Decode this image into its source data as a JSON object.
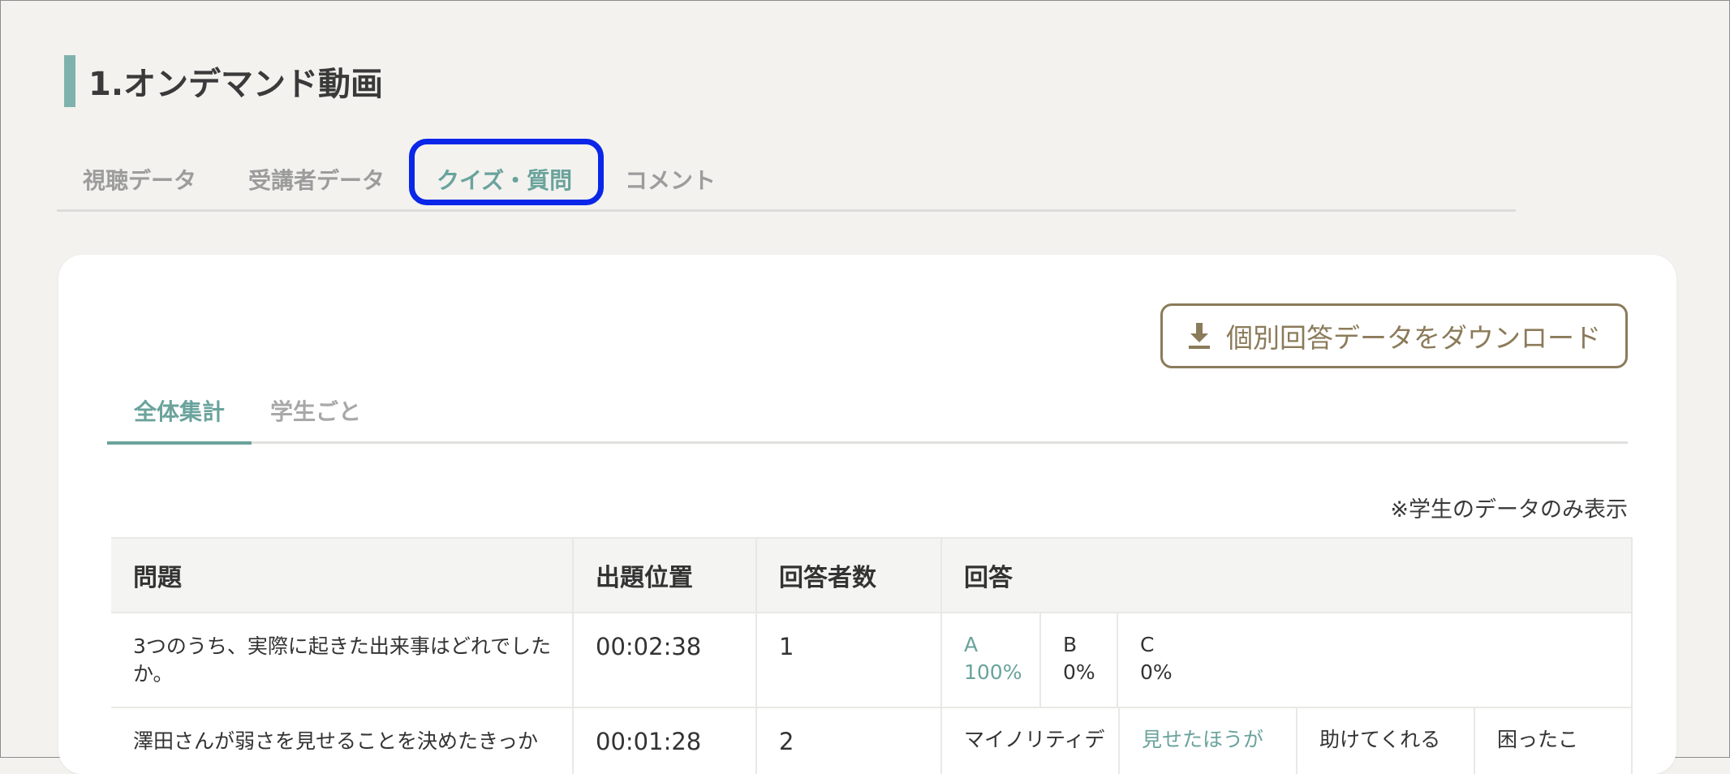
{
  "page": {
    "title": "1.オンデマンド動画"
  },
  "tabs": [
    {
      "label": "視聴データ"
    },
    {
      "label": "受講者データ"
    },
    {
      "label": "クイズ・質問"
    },
    {
      "label": "コメント"
    }
  ],
  "download_button": {
    "label": "個別回答データをダウンロード",
    "icon": "download-icon"
  },
  "subtabs": [
    {
      "label": "全体集計"
    },
    {
      "label": "学生ごと"
    }
  ],
  "note": "※学生のデータのみ表示",
  "table": {
    "headers": [
      "問題",
      "出題位置",
      "回答者数",
      "回答"
    ],
    "rows": [
      {
        "question": "3つのうち、実際に起きた出来事はどれでしたか。",
        "position": "00:02:38",
        "count": "1",
        "answers": [
          {
            "label": "A",
            "pct": "100%"
          },
          {
            "label": "B",
            "pct": "0%"
          },
          {
            "label": "C",
            "pct": "0%"
          }
        ]
      },
      {
        "question": "澤田さんが弱さを見せることを決めたきっか",
        "position": "00:01:28",
        "count": "2",
        "answers": [
          {
            "label": "マイノリティデ"
          },
          {
            "label": "見せたほうが"
          },
          {
            "label": "助けてくれる"
          },
          {
            "label": "困ったこ"
          }
        ]
      }
    ]
  },
  "colors": {
    "accent": "#6aa39c",
    "download": "#8b7b5a",
    "highlight": "#0a26e8"
  }
}
